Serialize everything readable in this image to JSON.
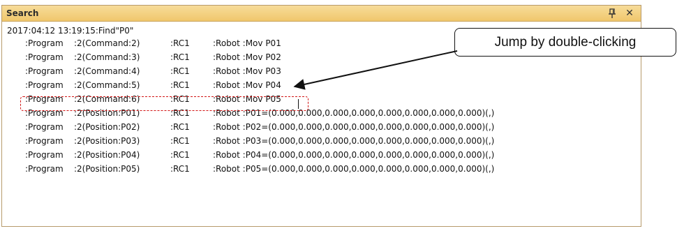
{
  "window": {
    "title": "Search",
    "pin_icon": "pin-icon",
    "close_glyph": "✕"
  },
  "results": {
    "header": "2017:04:12 13:19:15:Find\"P0\"",
    "rows": [
      {
        "type": ":Program",
        "location": ":2(Command:2)",
        "robot_id": ":RC1",
        "content": ":Robot :Mov P01"
      },
      {
        "type": ":Program",
        "location": ":2(Command:3)",
        "robot_id": ":RC1",
        "content": ":Robot :Mov P02"
      },
      {
        "type": ":Program",
        "location": ":2(Command:4)",
        "robot_id": ":RC1",
        "content": ":Robot :Mov P03"
      },
      {
        "type": ":Program",
        "location": ":2(Command:5)",
        "robot_id": ":RC1",
        "content": ":Robot :Mov P04"
      },
      {
        "type": ":Program",
        "location": ":2(Command:6)",
        "robot_id": ":RC1",
        "content": ":Robot :Mov P05"
      },
      {
        "type": ":Program",
        "location": ":2(Position:P01)",
        "robot_id": ":RC1",
        "content": ":Robot :P01=(0.000,0.000,0.000,0.000,0.000,0.000,0.000,0.000)(,)"
      },
      {
        "type": ":Program",
        "location": ":2(Position:P02)",
        "robot_id": ":RC1",
        "content": ":Robot :P02=(0.000,0.000,0.000,0.000,0.000,0.000,0.000,0.000)(,)"
      },
      {
        "type": ":Program",
        "location": ":2(Position:P03)",
        "robot_id": ":RC1",
        "content": ":Robot :P03=(0.000,0.000,0.000,0.000,0.000,0.000,0.000,0.000)(,)"
      },
      {
        "type": ":Program",
        "location": ":2(Position:P04)",
        "robot_id": ":RC1",
        "content": ":Robot :P04=(0.000,0.000,0.000,0.000,0.000,0.000,0.000,0.000)(,)"
      },
      {
        "type": ":Program",
        "location": ":2(Position:P05)",
        "robot_id": ":RC1",
        "content": ":Robot :P05=(0.000,0.000,0.000,0.000,0.000,0.000,0.000,0.000)(,)"
      }
    ]
  },
  "annotation": {
    "callout_text": "Jump by double-clicking",
    "highlight_color": "#d21414"
  }
}
